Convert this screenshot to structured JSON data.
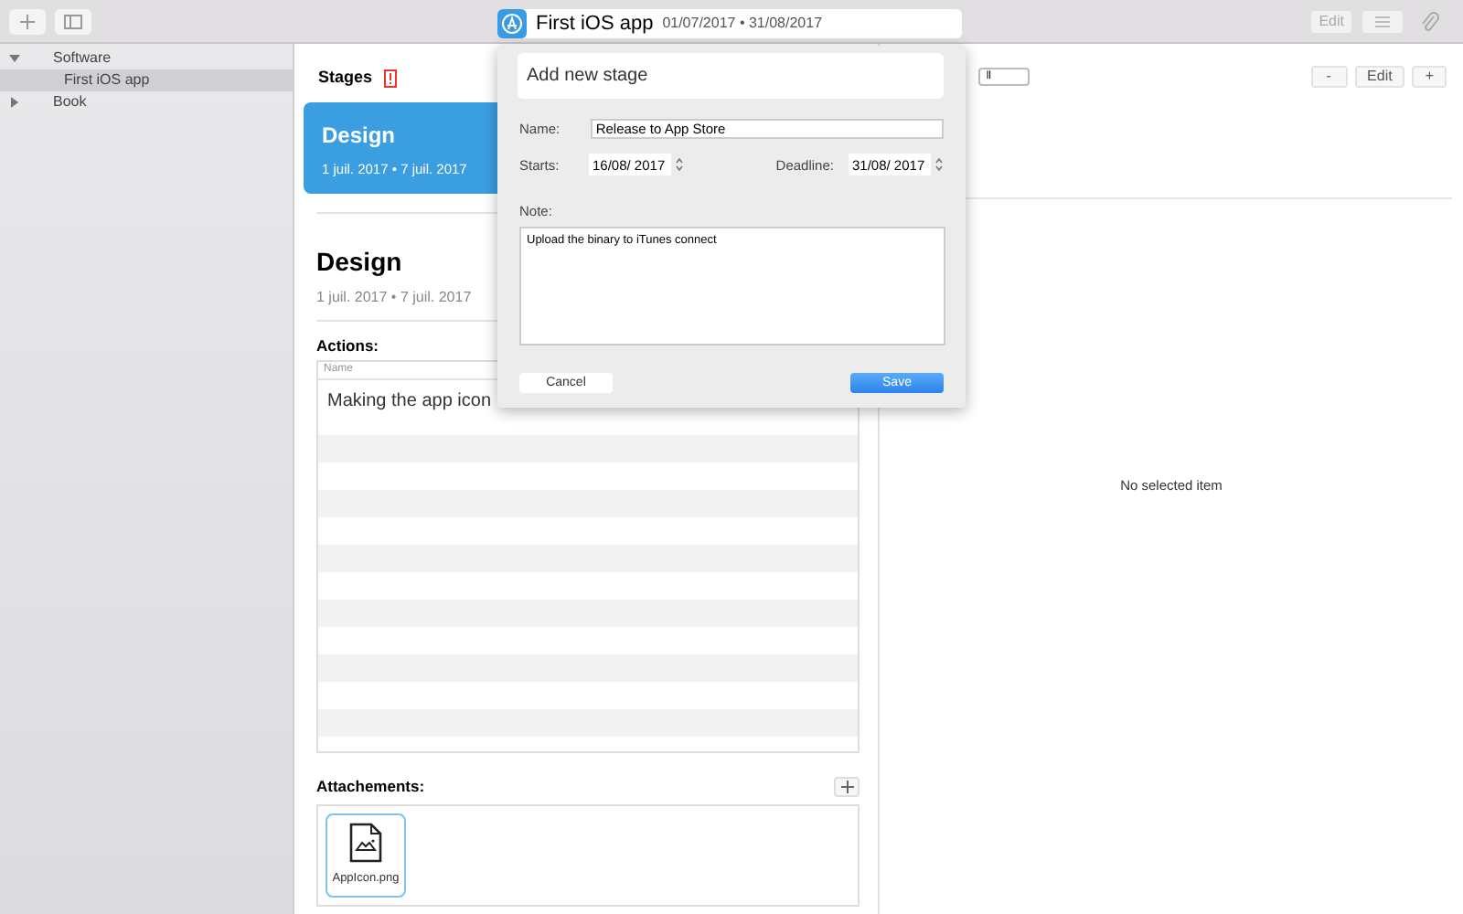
{
  "toolbar": {
    "title": "First iOS app",
    "dates": "01/07/2017 • 31/08/2017",
    "edit_label": "Edit"
  },
  "sidebar": {
    "items": [
      {
        "label": "Software",
        "expanded": true,
        "children": [
          {
            "label": "First iOS app",
            "selected": true
          }
        ]
      },
      {
        "label": "Book",
        "expanded": false
      }
    ]
  },
  "stages": {
    "title": "Stages",
    "cards": [
      {
        "name": "Design",
        "dates": "1 juil. 2017 • 7 juil. 2017",
        "selected": true
      }
    ]
  },
  "detail": {
    "title": "Design",
    "dates": "1 juil. 2017 • 7 juil. 2017",
    "actions_label": "Actions:",
    "column": "Name",
    "actions": [
      "Making the app icon"
    ],
    "attachments_label": "Attachements:",
    "attachments": [
      "AppIcon.png"
    ]
  },
  "right": {
    "segment": "ll",
    "buttons": [
      "-",
      "Edit",
      "+"
    ],
    "empty": "No selected item"
  },
  "popover": {
    "title": "Add new stage",
    "name_label": "Name:",
    "name": "Release to App Store",
    "starts_label": "Starts:",
    "starts": "16/08/ 2017",
    "deadline_label": "Deadline:",
    "deadline": "31/08/ 2017",
    "note_label": "Note:",
    "note": "Upload the binary to iTunes connect",
    "cancel": "Cancel",
    "save": "Save"
  }
}
